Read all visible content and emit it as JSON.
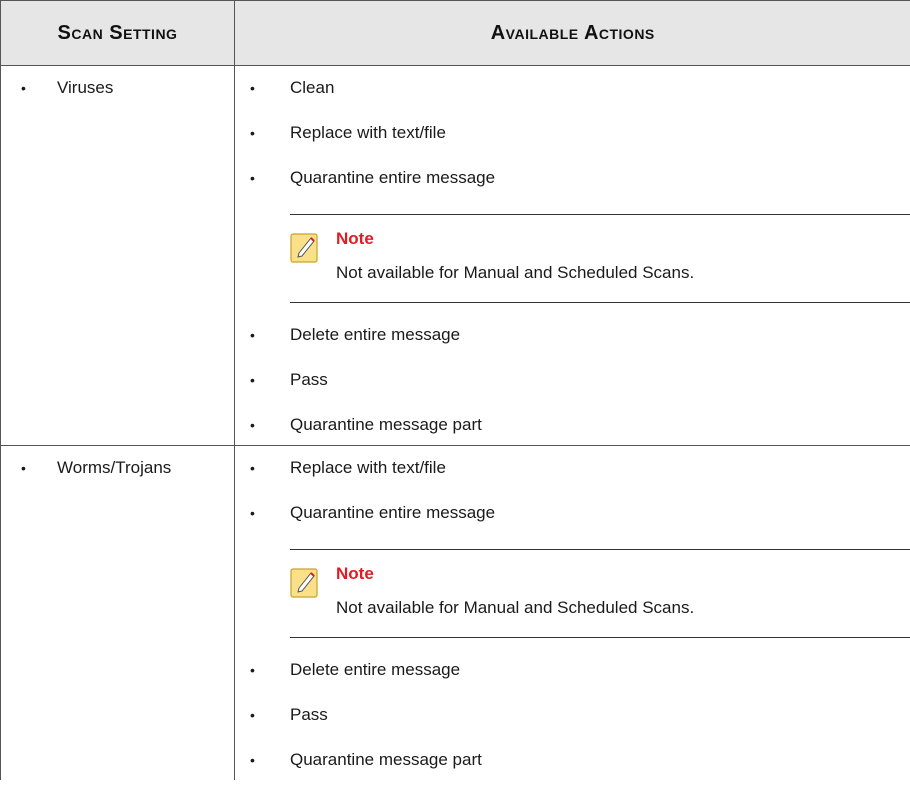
{
  "table": {
    "headers": [
      "Scan Setting",
      "Available Actions"
    ],
    "rows": [
      {
        "setting": "Viruses",
        "actions_before_note": [
          "Clean",
          "Replace with text/file",
          "Quarantine entire message"
        ],
        "note": {
          "title": "Note",
          "text": "Not available for Manual and Scheduled Scans."
        },
        "actions_after_note": [
          "Delete entire message",
          "Pass",
          "Quarantine message part"
        ]
      },
      {
        "setting": "Worms/Trojans",
        "actions_before_note": [
          "Replace with text/file",
          "Quarantine entire message"
        ],
        "note": {
          "title": "Note",
          "text": "Not available for Manual and Scheduled Scans."
        },
        "actions_after_note": [
          "Delete entire message",
          "Pass",
          "Quarantine message part"
        ]
      }
    ]
  },
  "bullet_glyph": "•",
  "icons": {
    "note": "note-pencil-icon"
  },
  "colors": {
    "note_title": "#e31b23",
    "note_icon_fill": "#fbe08a",
    "header_bg": "#e6e6e6"
  }
}
